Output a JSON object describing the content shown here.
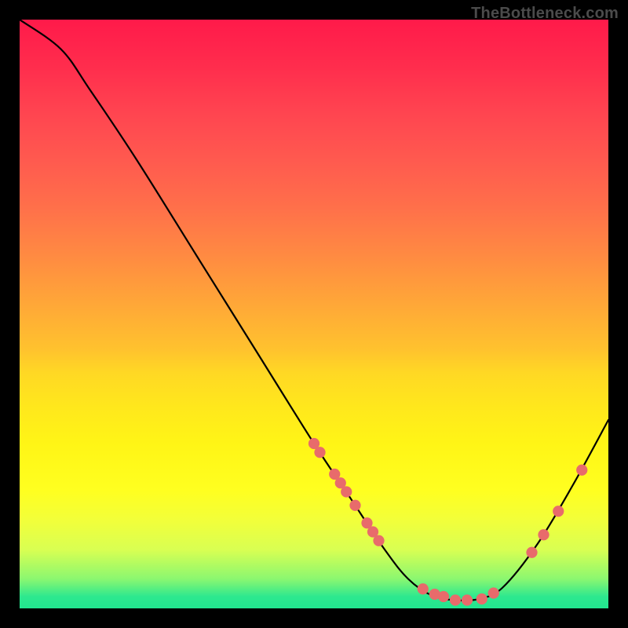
{
  "watermark": "TheBottleneck.com",
  "chart_data": {
    "type": "line",
    "title": "",
    "xlabel": "",
    "ylabel": "",
    "xlim": [
      0,
      100
    ],
    "ylim": [
      0,
      100
    ],
    "grid": false,
    "curve": [
      {
        "x": 0,
        "y": 100
      },
      {
        "x": 7,
        "y": 95
      },
      {
        "x": 12,
        "y": 88
      },
      {
        "x": 20,
        "y": 76
      },
      {
        "x": 30,
        "y": 60
      },
      {
        "x": 40,
        "y": 44
      },
      {
        "x": 50,
        "y": 28
      },
      {
        "x": 56,
        "y": 19
      },
      {
        "x": 62,
        "y": 10
      },
      {
        "x": 66,
        "y": 5
      },
      {
        "x": 70,
        "y": 2.2
      },
      {
        "x": 74,
        "y": 1.4
      },
      {
        "x": 78,
        "y": 1.6
      },
      {
        "x": 82,
        "y": 3.5
      },
      {
        "x": 88,
        "y": 11
      },
      {
        "x": 94,
        "y": 21
      },
      {
        "x": 100,
        "y": 32
      }
    ],
    "markers": [
      {
        "x": 50.0,
        "y": 28.0
      },
      {
        "x": 51.0,
        "y": 26.5
      },
      {
        "x": 53.5,
        "y": 22.8
      },
      {
        "x": 54.5,
        "y": 21.3
      },
      {
        "x": 55.5,
        "y": 19.8
      },
      {
        "x": 57.0,
        "y": 17.5
      },
      {
        "x": 59.0,
        "y": 14.5
      },
      {
        "x": 60.0,
        "y": 13.0
      },
      {
        "x": 61.0,
        "y": 11.5
      },
      {
        "x": 68.5,
        "y": 3.3
      },
      {
        "x": 70.5,
        "y": 2.4
      },
      {
        "x": 72.0,
        "y": 2.0
      },
      {
        "x": 74.0,
        "y": 1.4
      },
      {
        "x": 76.0,
        "y": 1.4
      },
      {
        "x": 78.5,
        "y": 1.6
      },
      {
        "x": 80.5,
        "y": 2.6
      },
      {
        "x": 87.0,
        "y": 9.5
      },
      {
        "x": 89.0,
        "y": 12.5
      },
      {
        "x": 91.5,
        "y": 16.5
      },
      {
        "x": 95.5,
        "y": 23.5
      }
    ],
    "marker_color": "#e86b6b",
    "curve_color": "#000000"
  }
}
